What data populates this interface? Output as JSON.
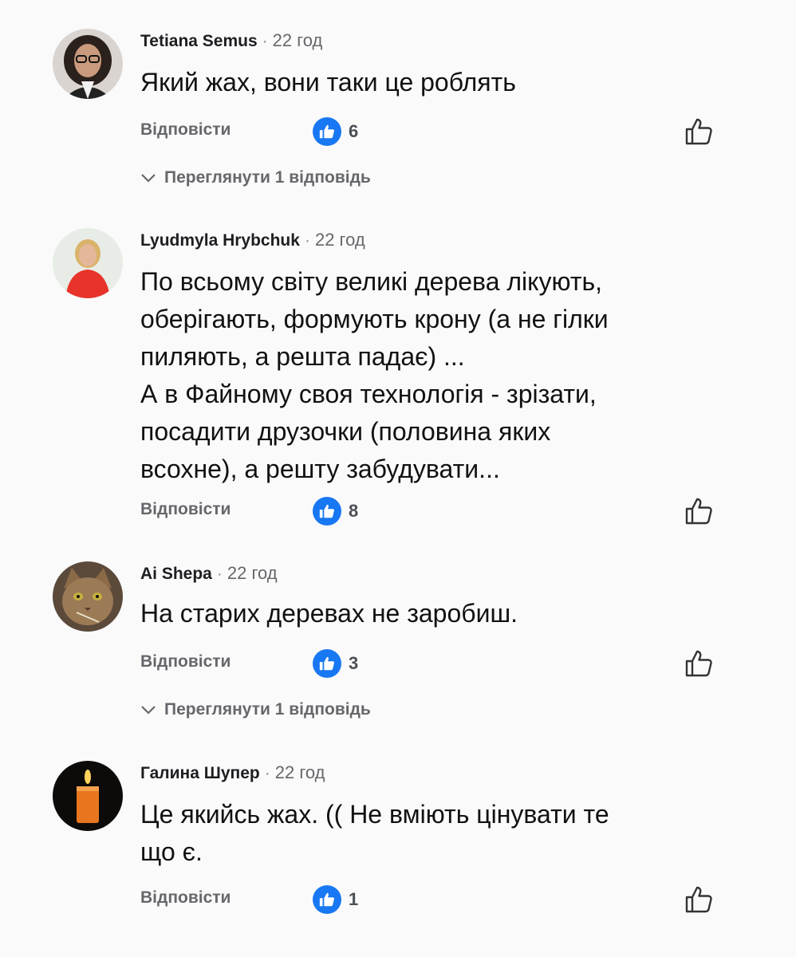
{
  "comments": [
    {
      "author": "Tetiana Semus",
      "time": "22 год",
      "text_lines": [
        "Який жах, вони таки це роблять"
      ],
      "reply_label": "Відповісти",
      "reaction_count": "6",
      "replies_label": "Переглянути 1 відповідь"
    },
    {
      "author": "Lyudmyla Hrybchuk",
      "time": "22 год",
      "text_lines": [
        "По всьому світу великі дерева лікують,",
        "оберігають, формують крону (а не гілки",
        "пиляють, а решта падає) ...",
        "А в Файному своя технологія - зрізати,",
        "посадити друзочки (половина яких",
        "всохне), а решту забудувати..."
      ],
      "reply_label": "Відповісти",
      "reaction_count": "8"
    },
    {
      "author": "Ai Shepa",
      "time": "22 год",
      "text_lines": [
        "На старих деревах не заробиш."
      ],
      "reply_label": "Відповісти",
      "reaction_count": "3",
      "replies_label": "Переглянути 1 відповідь"
    },
    {
      "author": "Галина Шупер",
      "time": "22 год",
      "text_lines": [
        "Це якийсь жах. (( Не вміють цінувати те",
        "що є."
      ],
      "reply_label": "Відповісти",
      "reaction_count": "1"
    }
  ],
  "separator": "·",
  "colors": {
    "like_blue": "#1877f2",
    "meta_gray": "#65676b",
    "text": "#111111"
  },
  "icons": {
    "reaction": "like-reaction-icon",
    "like_button": "thumbs-up-outline-icon",
    "expand": "chevron-down-icon"
  }
}
